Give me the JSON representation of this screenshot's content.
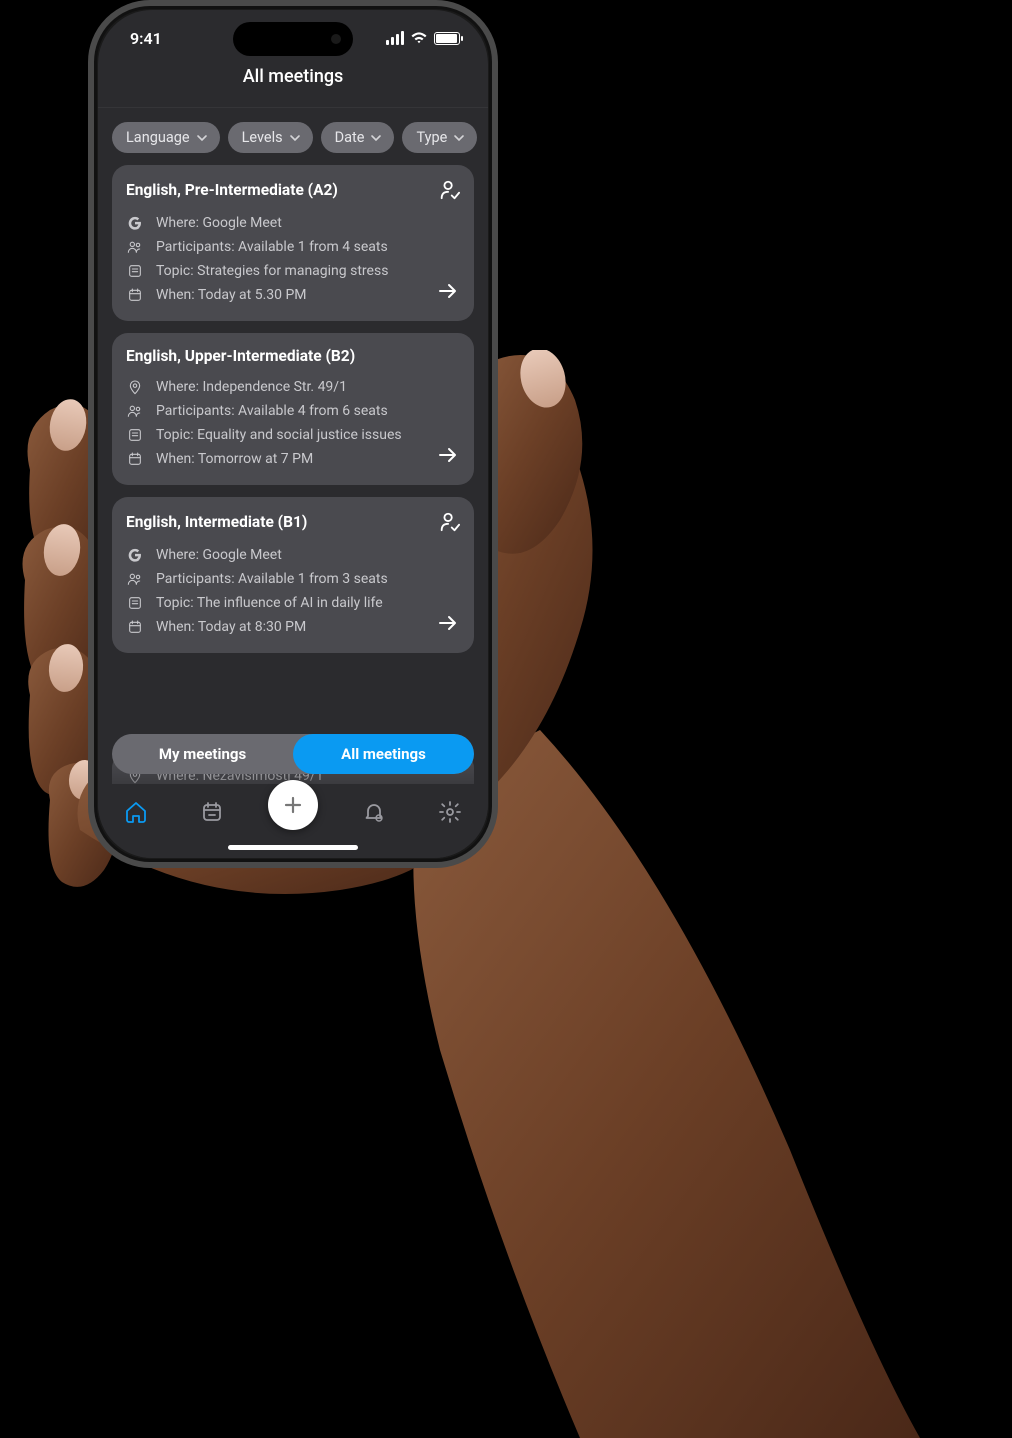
{
  "status": {
    "time": "9:41"
  },
  "header": {
    "title": "All meetings"
  },
  "filters": [
    {
      "label": "Language"
    },
    {
      "label": "Levels"
    },
    {
      "label": "Date"
    },
    {
      "label": "Type"
    }
  ],
  "meetings": [
    {
      "title": "English, Pre-Intermediate (A2)",
      "joined": true,
      "where_kind": "google",
      "where": "Where: Google Meet",
      "participants": "Participants: Available 1 from 4 seats",
      "topic": "Topic: Strategies for managing stress",
      "when": "When: Today at 5.30 PM"
    },
    {
      "title": "English, Upper-Intermediate (B2)",
      "joined": false,
      "where_kind": "location",
      "where": "Where: Independence Str. 49/1",
      "participants": "Participants: Available 4 from 6 seats",
      "topic": "Topic: Equality and social justice issues",
      "when": "When: Tomorrow at 7 PM"
    },
    {
      "title": "English, Intermediate (B1)",
      "joined": true,
      "where_kind": "google",
      "where": "Where: Google Meet",
      "participants": "Participants: Available 1 from 3 seats",
      "topic": "Topic: The influence of AI in daily life",
      "when": "When: Today at 8:30 PM"
    }
  ],
  "peek": {
    "where": "Where: Nezavisimosti 49/1"
  },
  "segmented": {
    "left": "My meetings",
    "right": "All meetings",
    "active": "right"
  },
  "colors": {
    "accent": "#0a9af2",
    "card": "#4a4a4f",
    "chip": "#6a6a70",
    "bg": "#2b2b2e"
  }
}
